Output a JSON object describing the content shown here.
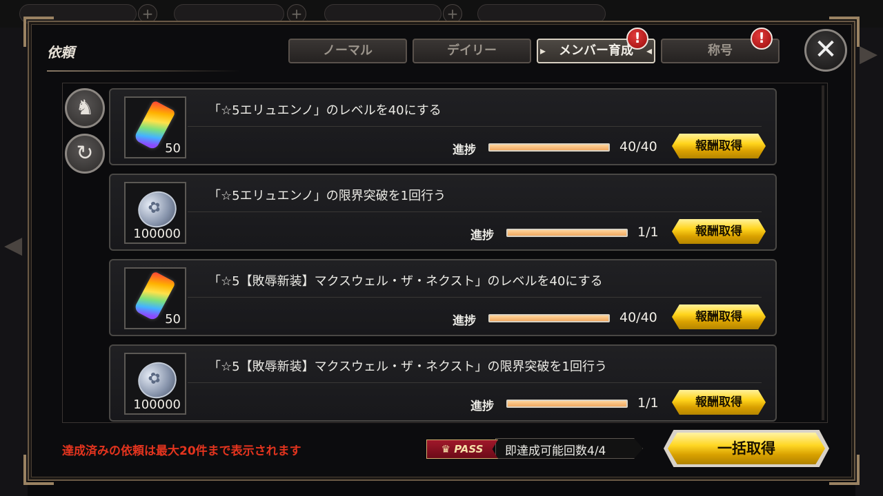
{
  "panel": {
    "title": "依頼"
  },
  "tabs": [
    {
      "label": "ノーマル",
      "active": false,
      "alert": false
    },
    {
      "label": "デイリー",
      "active": false,
      "alert": false
    },
    {
      "label": "メンバー育成",
      "active": true,
      "alert": true
    },
    {
      "label": "称号",
      "active": false,
      "alert": true
    }
  ],
  "alert_icon": "!",
  "close_icon": "✕",
  "quests": [
    {
      "text": "「☆5エリュエンノ」のレベルを40にする",
      "reward_icon": "rainbow-crystal-icon",
      "reward_count": "50",
      "progress_label": "進捗",
      "progress_value": "40/40",
      "progress_fraction": 1.0,
      "button": "報酬取得"
    },
    {
      "text": "「☆5エリュエンノ」の限界突破を1回行う",
      "reward_icon": "silver-coin-icon",
      "reward_count": "100000",
      "progress_label": "進捗",
      "progress_value": "1/1",
      "progress_fraction": 1.0,
      "button": "報酬取得"
    },
    {
      "text": "「☆5【敗辱新装】マクスウェル・ザ・ネクスト」のレベルを40にする",
      "reward_icon": "rainbow-crystal-icon",
      "reward_count": "50",
      "progress_label": "進捗",
      "progress_value": "40/40",
      "progress_fraction": 1.0,
      "button": "報酬取得"
    },
    {
      "text": "「☆5【敗辱新装】マクスウェル・ザ・ネクスト」の限界突破を1回行う",
      "reward_icon": "silver-coin-icon",
      "reward_count": "100000",
      "progress_label": "進捗",
      "progress_value": "1/1",
      "progress_fraction": 1.0,
      "button": "報酬取得"
    }
  ],
  "footer": {
    "note": "達成済みの依頼は最大20件まで表示されます",
    "pass_badge": "PASS",
    "pass_text": "即達成可能回数4/4",
    "bulk_button": "一括取得"
  },
  "colors": {
    "note": "#e3341e",
    "gold_button": "#ffd41c",
    "progress_fill": "#f0a860",
    "alert": "#c81818"
  }
}
